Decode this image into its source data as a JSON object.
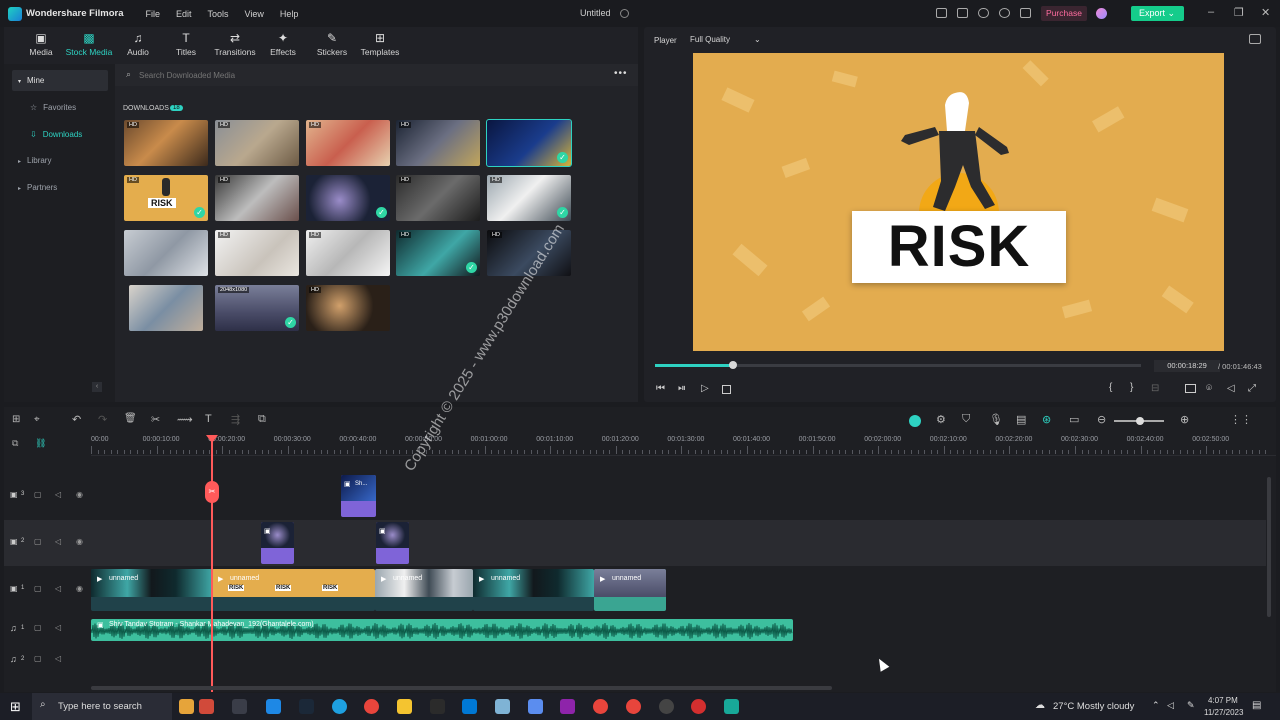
{
  "app": {
    "name": "Wondershare Filmora",
    "menu": [
      "File",
      "Edit",
      "Tools",
      "View",
      "Help"
    ],
    "project": "Untitled",
    "purchase": "Purchase",
    "export": "Export"
  },
  "toolbar": [
    {
      "label": "Media",
      "icon": "media-icon"
    },
    {
      "label": "Stock Media",
      "icon": "stock-media-icon"
    },
    {
      "label": "Audio",
      "icon": "audio-icon"
    },
    {
      "label": "Titles",
      "icon": "titles-icon"
    },
    {
      "label": "Transitions",
      "icon": "transitions-icon"
    },
    {
      "label": "Effects",
      "icon": "effects-icon"
    },
    {
      "label": "Stickers",
      "icon": "stickers-icon"
    },
    {
      "label": "Templates",
      "icon": "templates-icon"
    }
  ],
  "sidebar": {
    "mine": "Mine",
    "favorites": "Favorites",
    "downloads": "Downloads",
    "library": "Library",
    "partners": "Partners"
  },
  "media": {
    "search_placeholder": "Search Downloaded Media",
    "section": "DOWNLOADS",
    "count": "18",
    "resolution_badge": "2048x1080",
    "hd": "HD"
  },
  "player": {
    "label": "Player",
    "quality": "Full Quality",
    "current_time": "00:00:18:29",
    "total_time": "/ 00:01:46:43",
    "progress": 0.16,
    "video_text": "RISK"
  },
  "watermark": "Copyright © 2025 - www.p30download.com",
  "ruler": [
    "00:00",
    "00:00:10:00",
    "00:00:20:00",
    "00:00:30:00",
    "00:00:40:00",
    "00:00:50:00",
    "00:01:00:00",
    "00:01:10:00",
    "00:01:20:00",
    "00:01:30:00",
    "00:01:40:00",
    "00:01:50:00",
    "00:02:00:00",
    "00:02:10:00",
    "00:02:20:00",
    "00:02:30:00",
    "00:02:40:00",
    "00:02:50:00"
  ],
  "tracks": {
    "v3": "3",
    "v2": "2",
    "v1": "1",
    "a1": "1",
    "a2": "2"
  },
  "clips": {
    "video": [
      "unnamed",
      "unnamed",
      "unnamed",
      "unnamed",
      "unnamed"
    ],
    "audio": "Shiv Tandav Stotram - Shankar Mahadevan_192(Ghantalele.com)",
    "risk": "RISK",
    "sticker": "Sh..."
  },
  "taskbar": {
    "search": "Type here to search",
    "weather": "27°C  Mostly cloudy",
    "time": "4:07 PM",
    "date": "11/27/2023"
  },
  "colors": {
    "accent": "#2ed2c2",
    "export": "#15cc8b",
    "clip_video": "#2b4a4c",
    "clip_audio": "#3dbf9e",
    "playhead": "#ff5a5a",
    "sticker": "#8a6fe0"
  }
}
